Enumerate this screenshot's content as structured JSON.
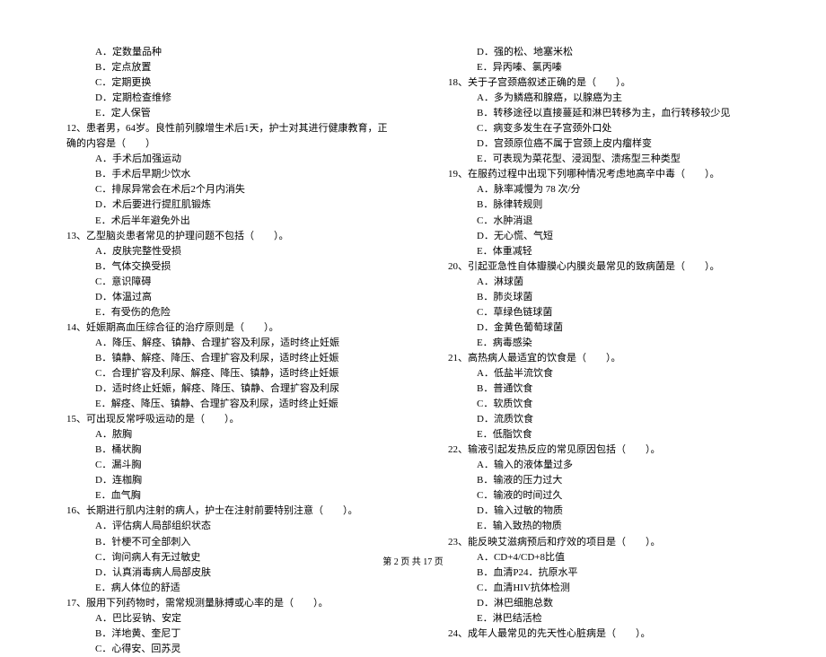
{
  "left": {
    "pre_options": [
      "A．定数量品种",
      "B．定点放置",
      "C．定期更换",
      "D．定期检查维修",
      "E．定人保管"
    ],
    "q12": {
      "stem": "12、患者男，64岁。良性前列腺增生术后1天，护士对其进行健康教育，正确的内容是（　　）",
      "opts": [
        "A．手术后加强运动",
        "B．手术后早期少饮水",
        "C．排尿异常会在术后2个月内消失",
        "D．术后要进行提肛肌锻炼",
        "E．术后半年避免外出"
      ]
    },
    "q13": {
      "stem": "13、乙型脑炎患者常见的护理问题不包括（　　）。",
      "opts": [
        "A．皮肤完整性受损",
        "B．气体交换受损",
        "C．意识障碍",
        "D．体温过高",
        "E．有受伤的危险"
      ]
    },
    "q14": {
      "stem": "14、妊娠期高血压综合征的治疗原则是（　　）。",
      "opts": [
        "A．降压、解痉、镇静、合理扩容及利尿，适时终止妊娠",
        "B．镇静、解痉、降压、合理扩容及利尿，适时终止妊娠",
        "C．合理扩容及利尿、解痉、降压、镇静，适时终止妊娠",
        "D．适时终止妊娠，解痉、降压、镇静、合理扩容及利尿",
        "E．解痉、降压、镇静、合理扩容及利尿，适时终止妊娠"
      ]
    },
    "q15": {
      "stem": "15、可出现反常呼吸运动的是（　　）。",
      "opts": [
        "A．脓胸",
        "B．桶状胸",
        "C．漏斗胸",
        "D．连枷胸",
        "E．血气胸"
      ]
    },
    "q16": {
      "stem": "16、长期进行肌内注射的病人，护士在注射前要特别注意（　　）。",
      "opts": [
        "A．评估病人局部组织状态",
        "B．针梗不可全部刺入",
        "C．询问病人有无过敏史",
        "D．认真消毒病人局部皮肤",
        "E．病人体位的舒适"
      ]
    },
    "q17": {
      "stem": "17、服用下列药物时，需常规测量脉搏或心率的是（　　）。",
      "opts": [
        "A．巴比妥钠、安定",
        "B．洋地黄、奎尼丁",
        "C．心得安、回苏灵"
      ]
    }
  },
  "right": {
    "pre_options": [
      "D．强的松、地塞米松",
      "E．异丙嗪、氯丙嗪"
    ],
    "q18": {
      "stem": "18、关于子宫颈癌叙述正确的是（　　）。",
      "opts": [
        "A．多为鳞癌和腺癌，以腺癌为主",
        "B．转移途径以直接蔓延和淋巴转移为主，血行转移较少见",
        "C．病变多发生在子宫颈外口处",
        "D．宫颈原位癌不属于宫颈上皮内瘤样变",
        "E．可表现为菜花型、浸润型、溃疡型三种类型"
      ]
    },
    "q19": {
      "stem": "19、在服药过程中出现下列哪种情况考虑地高辛中毒（　　）。",
      "opts": [
        "A．脉率减慢为 78 次/分",
        "B．脉律转规则",
        "C．水肿消退",
        "D．无心慌、气短",
        "E．体重减轻"
      ]
    },
    "q20": {
      "stem": "20、引起亚急性自体瓣膜心内膜炎最常见的致病菌是（　　）。",
      "opts": [
        "A．淋球菌",
        "B．肺炎球菌",
        "C．草绿色链球菌",
        "D．金黄色葡萄球菌",
        "E．病毒感染"
      ]
    },
    "q21": {
      "stem": "21、高热病人最适宜的饮食是（　　）。",
      "opts": [
        "A．低盐半流饮食",
        "B．普通饮食",
        "C．软质饮食",
        "D．流质饮食",
        "E．低脂饮食"
      ]
    },
    "q22": {
      "stem": "22、输液引起发热反应的常见原因包括（　　）。",
      "opts": [
        "A．输入的液体量过多",
        "B．输液的压力过大",
        "C．输液的时间过久",
        "D．输入过敏的物质",
        "E．输入致热的物质"
      ]
    },
    "q23": {
      "stem": "23、能反映艾滋病预后和疗效的项目是（　　）。",
      "opts": [
        "A．CD+4/CD+8比值",
        "B．血清P24．抗原水平",
        "C．血清HIV抗体检测",
        "D．淋巴细胞总数",
        "E．淋巴结活检"
      ]
    },
    "q24": {
      "stem": "24、成年人最常见的先天性心脏病是（　　）。"
    }
  },
  "footer": "第 2 页 共 17 页"
}
